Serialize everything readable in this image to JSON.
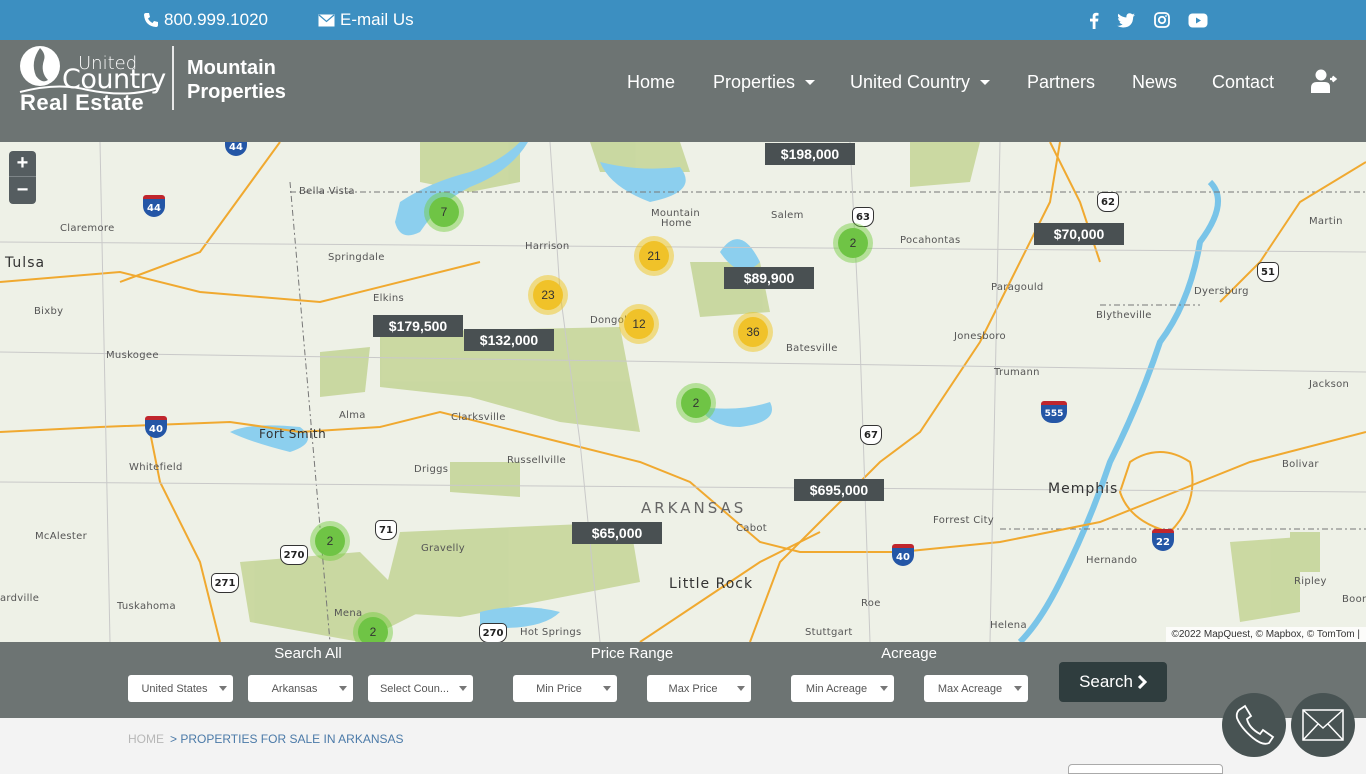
{
  "topbar": {
    "phone": "800.999.1020",
    "email_label": "E-mail Us",
    "social": [
      "facebook-icon",
      "twitter-icon",
      "instagram-icon",
      "youtube-icon"
    ]
  },
  "header": {
    "logo": {
      "line1": "United",
      "line2": "Country",
      "line3": "Real Estate",
      "office_line1": "Mountain",
      "office_line2": "Properties"
    },
    "nav": [
      {
        "label": "Home",
        "dropdown": false
      },
      {
        "label": "Properties",
        "dropdown": true
      },
      {
        "label": "United Country",
        "dropdown": true
      },
      {
        "label": "Partners",
        "dropdown": false
      },
      {
        "label": "News",
        "dropdown": false
      },
      {
        "label": "Contact",
        "dropdown": false
      }
    ],
    "user_icon": "user-plus-icon"
  },
  "map": {
    "zoom_in": "+",
    "zoom_out": "−",
    "price_markers": [
      "$198,000",
      "$70,000",
      "$89,900",
      "$179,500",
      "$132,000",
      "$695,000",
      "$65,000"
    ],
    "clusters": [
      {
        "count": "7",
        "color": "green"
      },
      {
        "count": "21",
        "color": "yellow"
      },
      {
        "count": "2",
        "color": "green"
      },
      {
        "count": "23",
        "color": "yellow"
      },
      {
        "count": "12",
        "color": "yellow"
      },
      {
        "count": "36",
        "color": "yellow"
      },
      {
        "count": "2",
        "color": "green"
      },
      {
        "count": "2",
        "color": "green"
      },
      {
        "count": "2",
        "color": "green"
      }
    ],
    "places": [
      "Bella Vista",
      "Claremore",
      "Tulsa",
      "Springdale",
      "Bixby",
      "Elkins",
      "Muskogee",
      "Harrison",
      "Mountain",
      "Home",
      "Salem",
      "Pocahontas",
      "Paragould",
      "Dongol",
      "Batesville",
      "Jonesboro",
      "Blytheville",
      "Dyersburg",
      "Martin",
      "Trumann",
      "Jackson",
      "Alma",
      "Fort Smith",
      "Clarksville",
      "Whitefield",
      "Russellville",
      "Driggs",
      "ARKANSAS",
      "Cabot",
      "Memphis",
      "Bolivar",
      "Forrest City",
      "McAlester",
      "Gravelly",
      "Hernando",
      "Little Rock",
      "Tuskahoma",
      "Ripley",
      "ardville",
      "Mena",
      "Roe",
      "Hot Springs",
      "Stuttgart",
      "Helena",
      "Boon"
    ],
    "shields": [
      "63",
      "62",
      "51",
      "67",
      "71",
      "270",
      "271",
      "270"
    ],
    "interstates": [
      "44",
      "44",
      "40",
      "555",
      "40",
      "22"
    ],
    "attribution": "©2022 MapQuest, © Mapbox, © TomTom |"
  },
  "search": {
    "groups": {
      "all": "Search All",
      "price": "Price Range",
      "acreage": "Acreage"
    },
    "country": "United States",
    "state": "Arkansas",
    "county": "Select Coun...",
    "min_price": "Min Price",
    "max_price": "Max Price",
    "min_acreage": "Min Acreage",
    "max_acreage": "Max Acreage",
    "button": "Search"
  },
  "breadcrumb": {
    "home": "HOME",
    "current": "> PROPERTIES FOR SALE IN ARKANSAS"
  },
  "colors": {
    "topbar": "#3c8fc1",
    "header": "#6d7473",
    "search_button": "#2f3d3e",
    "price_marker": "#495052",
    "cluster_green": "#6fc445",
    "cluster_yellow": "#f0c229"
  }
}
